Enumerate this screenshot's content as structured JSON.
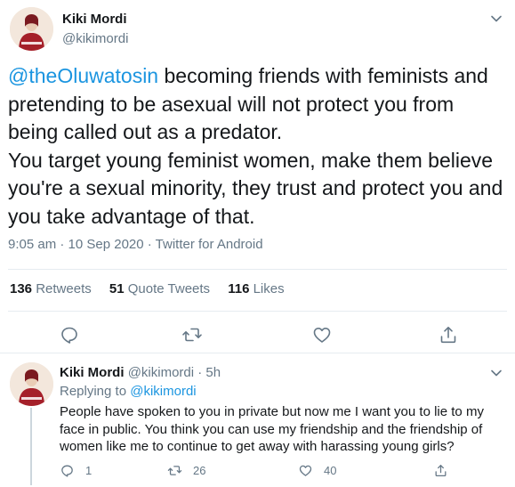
{
  "main_tweet": {
    "author_name": "Kiki Mordi",
    "author_handle": "@kikimordi",
    "mention": "@theOluwatosin",
    "text_lines": [
      " becoming friends with feminists and",
      "pretending to be asexual will not protect you from",
      "being called out as a predator.",
      "You target young feminist women, make them believe",
      "you're a sexual minority, they trust and protect you and",
      "you take advantage of that."
    ],
    "meta": "9:05 am · 10 Sep 2020 · Twitter for Android",
    "stats": {
      "retweets_count": "136",
      "retweets_label": "Retweets",
      "quote_count": "51",
      "quote_label": "Quote Tweets",
      "likes_count": "116",
      "likes_label": "Likes"
    },
    "actions": [
      "reply-icon",
      "retweet-icon",
      "like-icon",
      "share-icon"
    ]
  },
  "reply_tweet": {
    "author_name": "Kiki Mordi",
    "handle_time": "@kikimordi · 5h",
    "replying_prefix": "Replying to ",
    "replying_mention": "@kikimordi",
    "text_lines": [
      "People have spoken to you in private but now me I want you to lie to my",
      "face in public. You think you can use my friendship and the friendship of",
      "women like me to continue to get away with harassing young girls?"
    ],
    "reply_count": "1",
    "retweet_count": "26",
    "like_count": "40"
  },
  "colors": {
    "link": "#1b95e0",
    "secondary_text": "#657786",
    "divider": "#e6ecf0",
    "avatar_accent": "#a5202a"
  }
}
